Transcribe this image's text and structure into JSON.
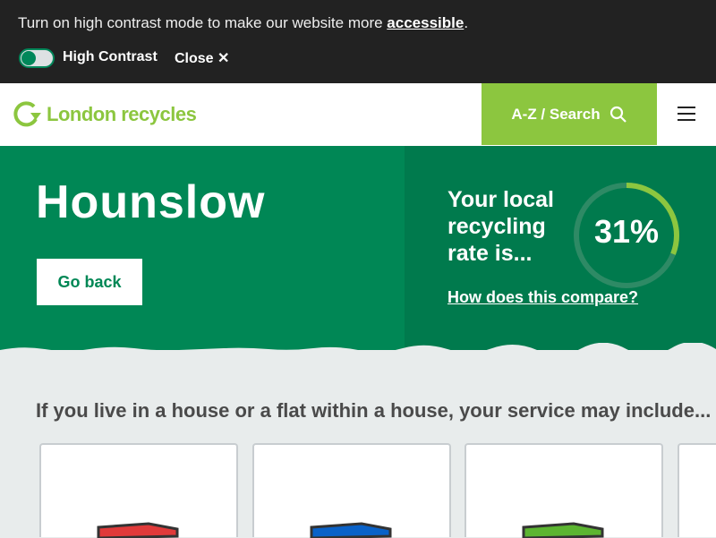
{
  "banner": {
    "message": "Turn on high contrast mode to make our website more ",
    "link": "accessible",
    "period": ".",
    "toggle_label": "High Contrast",
    "toggle_on": false,
    "close_label": "Close ✕"
  },
  "header": {
    "logo_text": "London recycles",
    "search_label": "A-Z / Search",
    "menu_icon": "hamburger-icon"
  },
  "hero": {
    "title": "Hounslow",
    "back_label": "Go back",
    "rate_line1": "Your local",
    "rate_line2": "recycling",
    "rate_line3": "rate is...",
    "rate_value": "31%",
    "rate_percent": 31,
    "compare_link": "How does this compare?"
  },
  "services": {
    "heading": "If you live in a house or a flat within a house, your service may include...",
    "bins": [
      {
        "color": "#e03a3a"
      },
      {
        "color": "#0a62c8"
      },
      {
        "color": "#5cb531"
      }
    ]
  },
  "colors": {
    "brand_green": "#008755",
    "accent_lime": "#8cc63f"
  }
}
